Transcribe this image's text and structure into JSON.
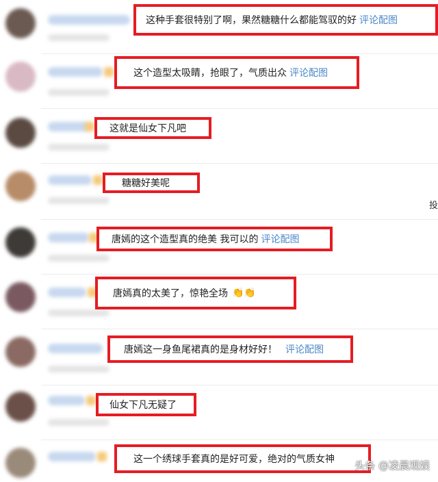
{
  "colors": {
    "highlight_border": "#e51c23",
    "link": "#4a87c8",
    "text": "#222222"
  },
  "comments": [
    {
      "text": "这种手套很特别了啊，果然糖糖什么都能驾驭的好",
      "link": "评论配图",
      "emoji": ""
    },
    {
      "text": "这个造型太吸睛，抢眼了，气质出众",
      "link": "评论配图",
      "emoji": ""
    },
    {
      "text": "这就是仙女下凡吧",
      "link": "",
      "emoji": ""
    },
    {
      "text": "糖糖好美呢",
      "link": "",
      "emoji": ""
    },
    {
      "text": "唐嫣的这个造型真的绝美 我可以的",
      "link": "评论配图",
      "emoji": ""
    },
    {
      "text": "唐嫣真的太美了，惊艳全场",
      "link": "",
      "emoji": "👏👏"
    },
    {
      "text": "唐嫣这一身鱼尾裙真的是身材好好！",
      "link": "评论配图",
      "emoji": ""
    },
    {
      "text": "仙女下凡无疑了",
      "link": "",
      "emoji": ""
    },
    {
      "text": "这一个绣球手套真的是好可爱，绝对的气质女神",
      "link": "",
      "emoji": ""
    }
  ],
  "edge_char": "投",
  "watermark": "头条 @凌晨观娱"
}
